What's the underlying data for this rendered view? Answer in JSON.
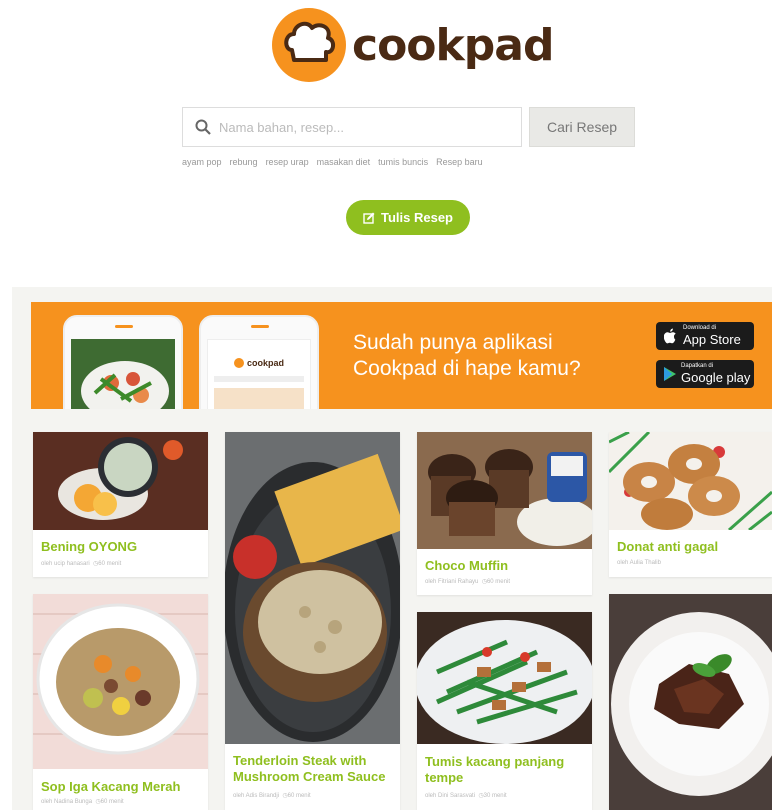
{
  "brand": {
    "name": "cookpad"
  },
  "search": {
    "placeholder": "Nama bahan, resep...",
    "button_label": "Cari Resep"
  },
  "keywords": [
    "ayam pop",
    "rebung",
    "resep urap",
    "masakan diet",
    "tumis buncis",
    "Resep baru"
  ],
  "write_recipe": {
    "label": "Tulis Resep"
  },
  "banner": {
    "line1": "Sudah punya aplikasi",
    "line2": "Cookpad di hape kamu?",
    "app_store": {
      "small": "Download di",
      "label": "App Store"
    },
    "google_play": {
      "small": "Dapatkan di",
      "label": "Google play"
    }
  },
  "recipes": [
    {
      "title": "Bening OYONG",
      "author": "oleh ucip hanasari",
      "time": "60 menit"
    },
    {
      "title": "Tenderloin Steak with Mushroom Cream Sauce",
      "author": "oleh Adis Birandji",
      "time": "60 menit"
    },
    {
      "title": "Choco Muffin",
      "author": "oleh Fitriani Rahayu",
      "time": "60 menit"
    },
    {
      "title": "Donat anti gagal",
      "author": "oleh Aulia Thalib",
      "time": ""
    },
    {
      "title": "Sop Iga Kacang Merah",
      "author": "oleh Nadina Bunga",
      "time": "60 menit"
    },
    {
      "title": "Tumis kacang panjang tempe",
      "author": "oleh Dini Sarasvati",
      "time": "30 menit"
    }
  ],
  "colors": {
    "brand_orange": "#f6921e",
    "green": "#8fbf1f",
    "logo_brown": "#4a2a14"
  }
}
